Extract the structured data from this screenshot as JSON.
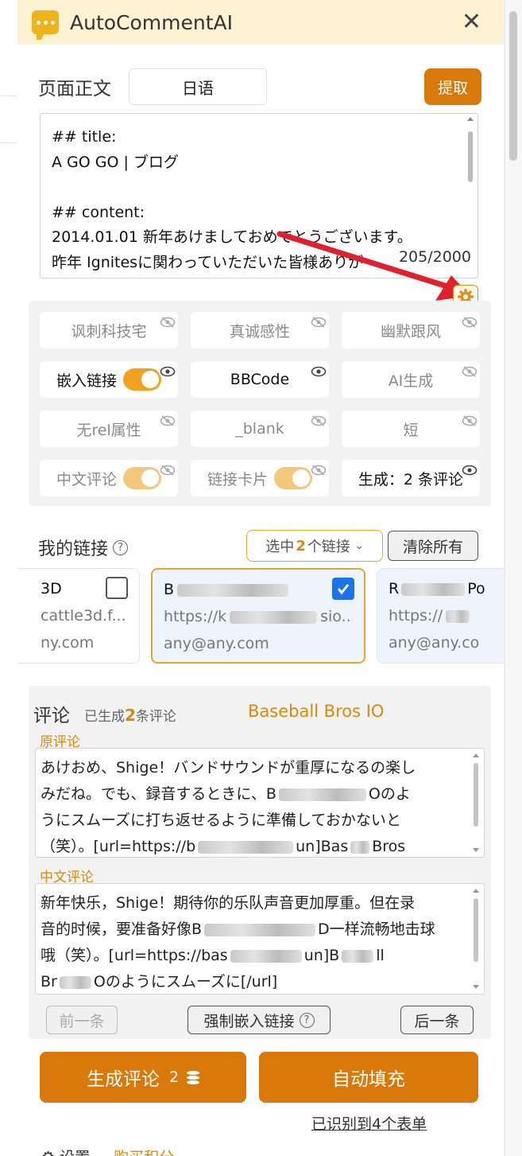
{
  "app": {
    "title": "AutoCommentAI"
  },
  "page": {
    "label": "页面正文",
    "language": "日语",
    "extract_label": "提取",
    "lines": [
      "## title:",
      "A GO GO | ブログ",
      "",
      "## content:",
      "2014.01.01 新年あけましておめでとうございます。",
      "昨年 Ignitesに関わっていただいた皆様ありが"
    ],
    "counter": "205/2000"
  },
  "options": [
    {
      "label": "讽刺科技宅",
      "active": false
    },
    {
      "label": "真诚感性",
      "active": false
    },
    {
      "label": "幽默跟风",
      "active": false
    },
    {
      "label": "嵌入链接",
      "active": true,
      "toggle": true
    },
    {
      "label": "BBCode",
      "active": true
    },
    {
      "label": "AI生成",
      "active": false
    },
    {
      "label": "无rel属性",
      "active": false
    },
    {
      "label": "_blank",
      "active": false
    },
    {
      "label": "短",
      "active": false
    },
    {
      "label": "中文评论",
      "active": false,
      "toggle": true
    },
    {
      "label": "链接卡片",
      "active": false,
      "toggle": true
    },
    {
      "label": "生成：2 条评论",
      "active": true
    }
  ],
  "links": {
    "title": "我的链接",
    "select_prefix": "选中",
    "select_count": "2",
    "select_suffix": "个链接",
    "clear_label": "清除所有",
    "cards": [
      {
        "name": "3D",
        "url": "cattle3d.f...",
        "email": "ny.com",
        "checked": false
      },
      {
        "name": "B",
        "url": "https://k",
        "url_tail": "sio...",
        "email": "any@any.com",
        "checked": true
      },
      {
        "name": "R",
        "name_tail": "Po",
        "url": "https://",
        "email": "any@any.co",
        "checked": false
      }
    ]
  },
  "comments": {
    "title": "评论",
    "count_prefix": "已生成",
    "count": "2",
    "count_suffix": "条评论",
    "target_name": "Baseball Bros IO",
    "original_label": "原评论",
    "original_lines": [
      "あけおめ、Shige！バンドサウンドが重厚になるの楽し",
      "みだね。でも、録音するときに、B",
      "うにスムーズに打ち返せるように準備しておかないと",
      "（笑）。[url=https://b",
      "un]Bas",
      "Bros"
    ],
    "original_tail": "Oのよ",
    "chinese_label": "中文评论",
    "chinese_lines": [
      "新年快乐，Shige！期待你的乐队声音更加厚重。但在录",
      "音的时候，要准备好像B",
      "D一样流畅地击球",
      "哦（笑）。[url=https://bas",
      "un]B",
      "ll",
      "Br",
      "Oのようにスムーズに[/url]"
    ],
    "prev_label": "前一条",
    "force_label": "强制嵌入链接",
    "next_label": "后一条"
  },
  "actions": {
    "generate_label": "生成评论",
    "generate_cost": "2",
    "autofill_label": "自动填充",
    "forms_prefix": "已识别到",
    "forms_count": "4",
    "forms_suffix": "个表单"
  },
  "footer": {
    "settings_label": "设置",
    "buy_label": "购买积分"
  },
  "colors": {
    "accent": "#d9790b",
    "header_bg": "#fdf3d2",
    "checkbox": "#1a73e8",
    "arrow": "#e0202a"
  }
}
